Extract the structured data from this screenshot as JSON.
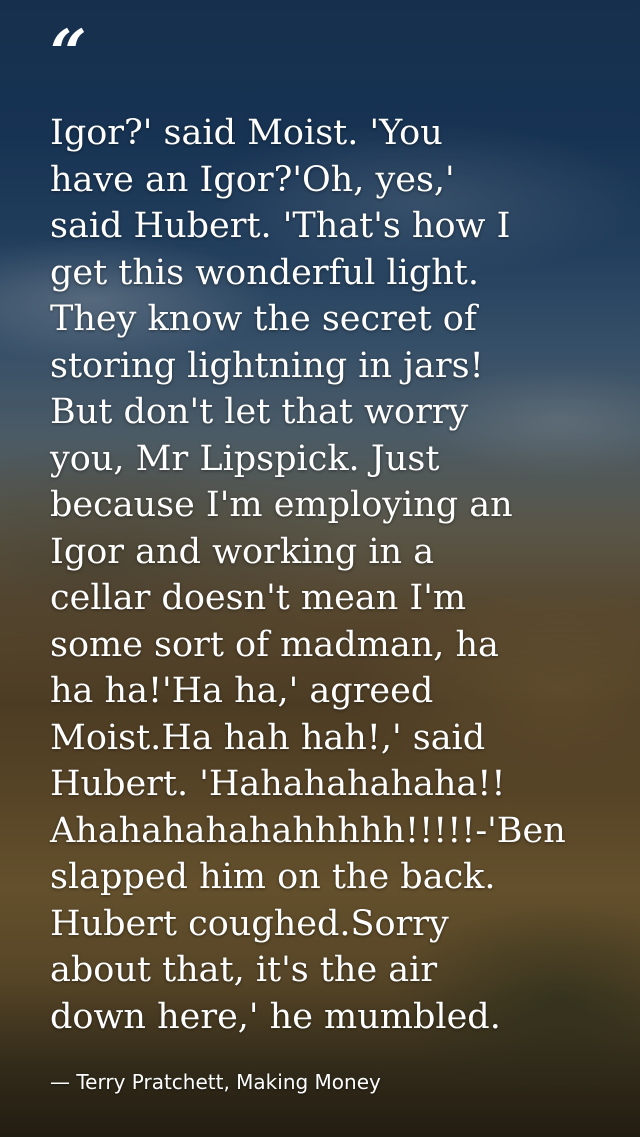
{
  "quote": {
    "mark": "“",
    "lines": [
      "Igor?' said Moist. 'You",
      "have an Igor?'Oh, yes,'",
      "said Hubert. 'That's how I",
      "get this wonderful light.",
      "They know the secret of",
      "storing lightning in jars!",
      "But don't let that worry",
      "you, Mr Lipspick. Just",
      "because I'm employing an",
      "Igor and working in a",
      "cellar doesn't mean I'm",
      "some sort of madman, ha",
      "ha ha!'Ha ha,' agreed",
      "Moist.Ha hah hah!,' said",
      "Hubert. 'Hahahahahaha!!",
      "Ahahahahahahhhhh!!!!!-'Ben",
      "slapped him on the back.",
      "Hubert coughed.Sorry",
      "about that, it's the air",
      "down here,' he mumbled."
    ],
    "attribution": "— Terry Pratchett, Making Money"
  },
  "colors": {
    "text": "#ffffff",
    "sky_top": "#1b3a5e",
    "hills": "#6b5430"
  }
}
